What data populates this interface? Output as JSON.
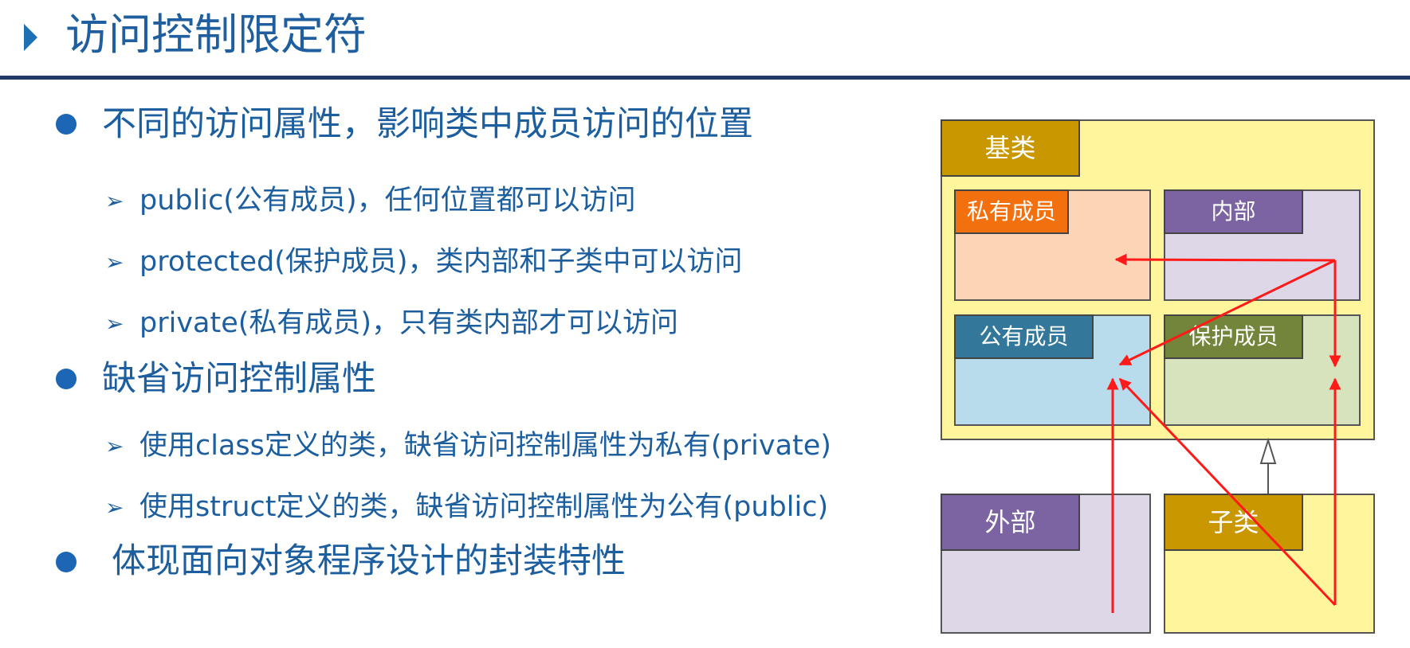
{
  "title": "访问控制限定符",
  "bullets": [
    {
      "text": "不同的访问属性，影响类中成员访问的位置",
      "subs": [
        "public(公有成员)，任何位置都可以访问",
        "protected(保护成员)，类内部和子类中可以访问",
        "private(私有成员)，只有类内部才可以访问"
      ]
    },
    {
      "text": "缺省访问控制属性",
      "subs": [
        "使用class定义的类，缺省访问控制属性为私有(private)",
        "使用struct定义的类，缺省访问控制属性为公有(public)"
      ]
    },
    {
      "text": "体现面向对象程序设计的封装特性",
      "subs": []
    }
  ],
  "diagram": {
    "base_class": "基类",
    "private_member": "私有成员",
    "internal": "内部",
    "public_member": "公有成员",
    "protected_member": "保护成员",
    "external": "外部",
    "subclass": "子类"
  },
  "colors": {
    "title": "#1f5f9f",
    "bullet": "#1c66b5",
    "rule": "#1f3864",
    "arrow": "#ff1a1a",
    "base_bg": "#fff59d",
    "base_tag": "#c99700",
    "private_bg": "#fbd5b5",
    "private_tag": "#f2700d",
    "internal_bg": "#ddd7e8",
    "internal_tag": "#7b64a1",
    "public_bg": "#b9dcec",
    "public_tag": "#33789a",
    "protected_bg": "#d6e3bd",
    "protected_tag": "#73853a"
  },
  "icons": [
    "title-triangle-icon",
    "bullet-dot-icon",
    "chevron-right-icon",
    "arrow-icon",
    "inheritance-arrow-icon"
  ]
}
